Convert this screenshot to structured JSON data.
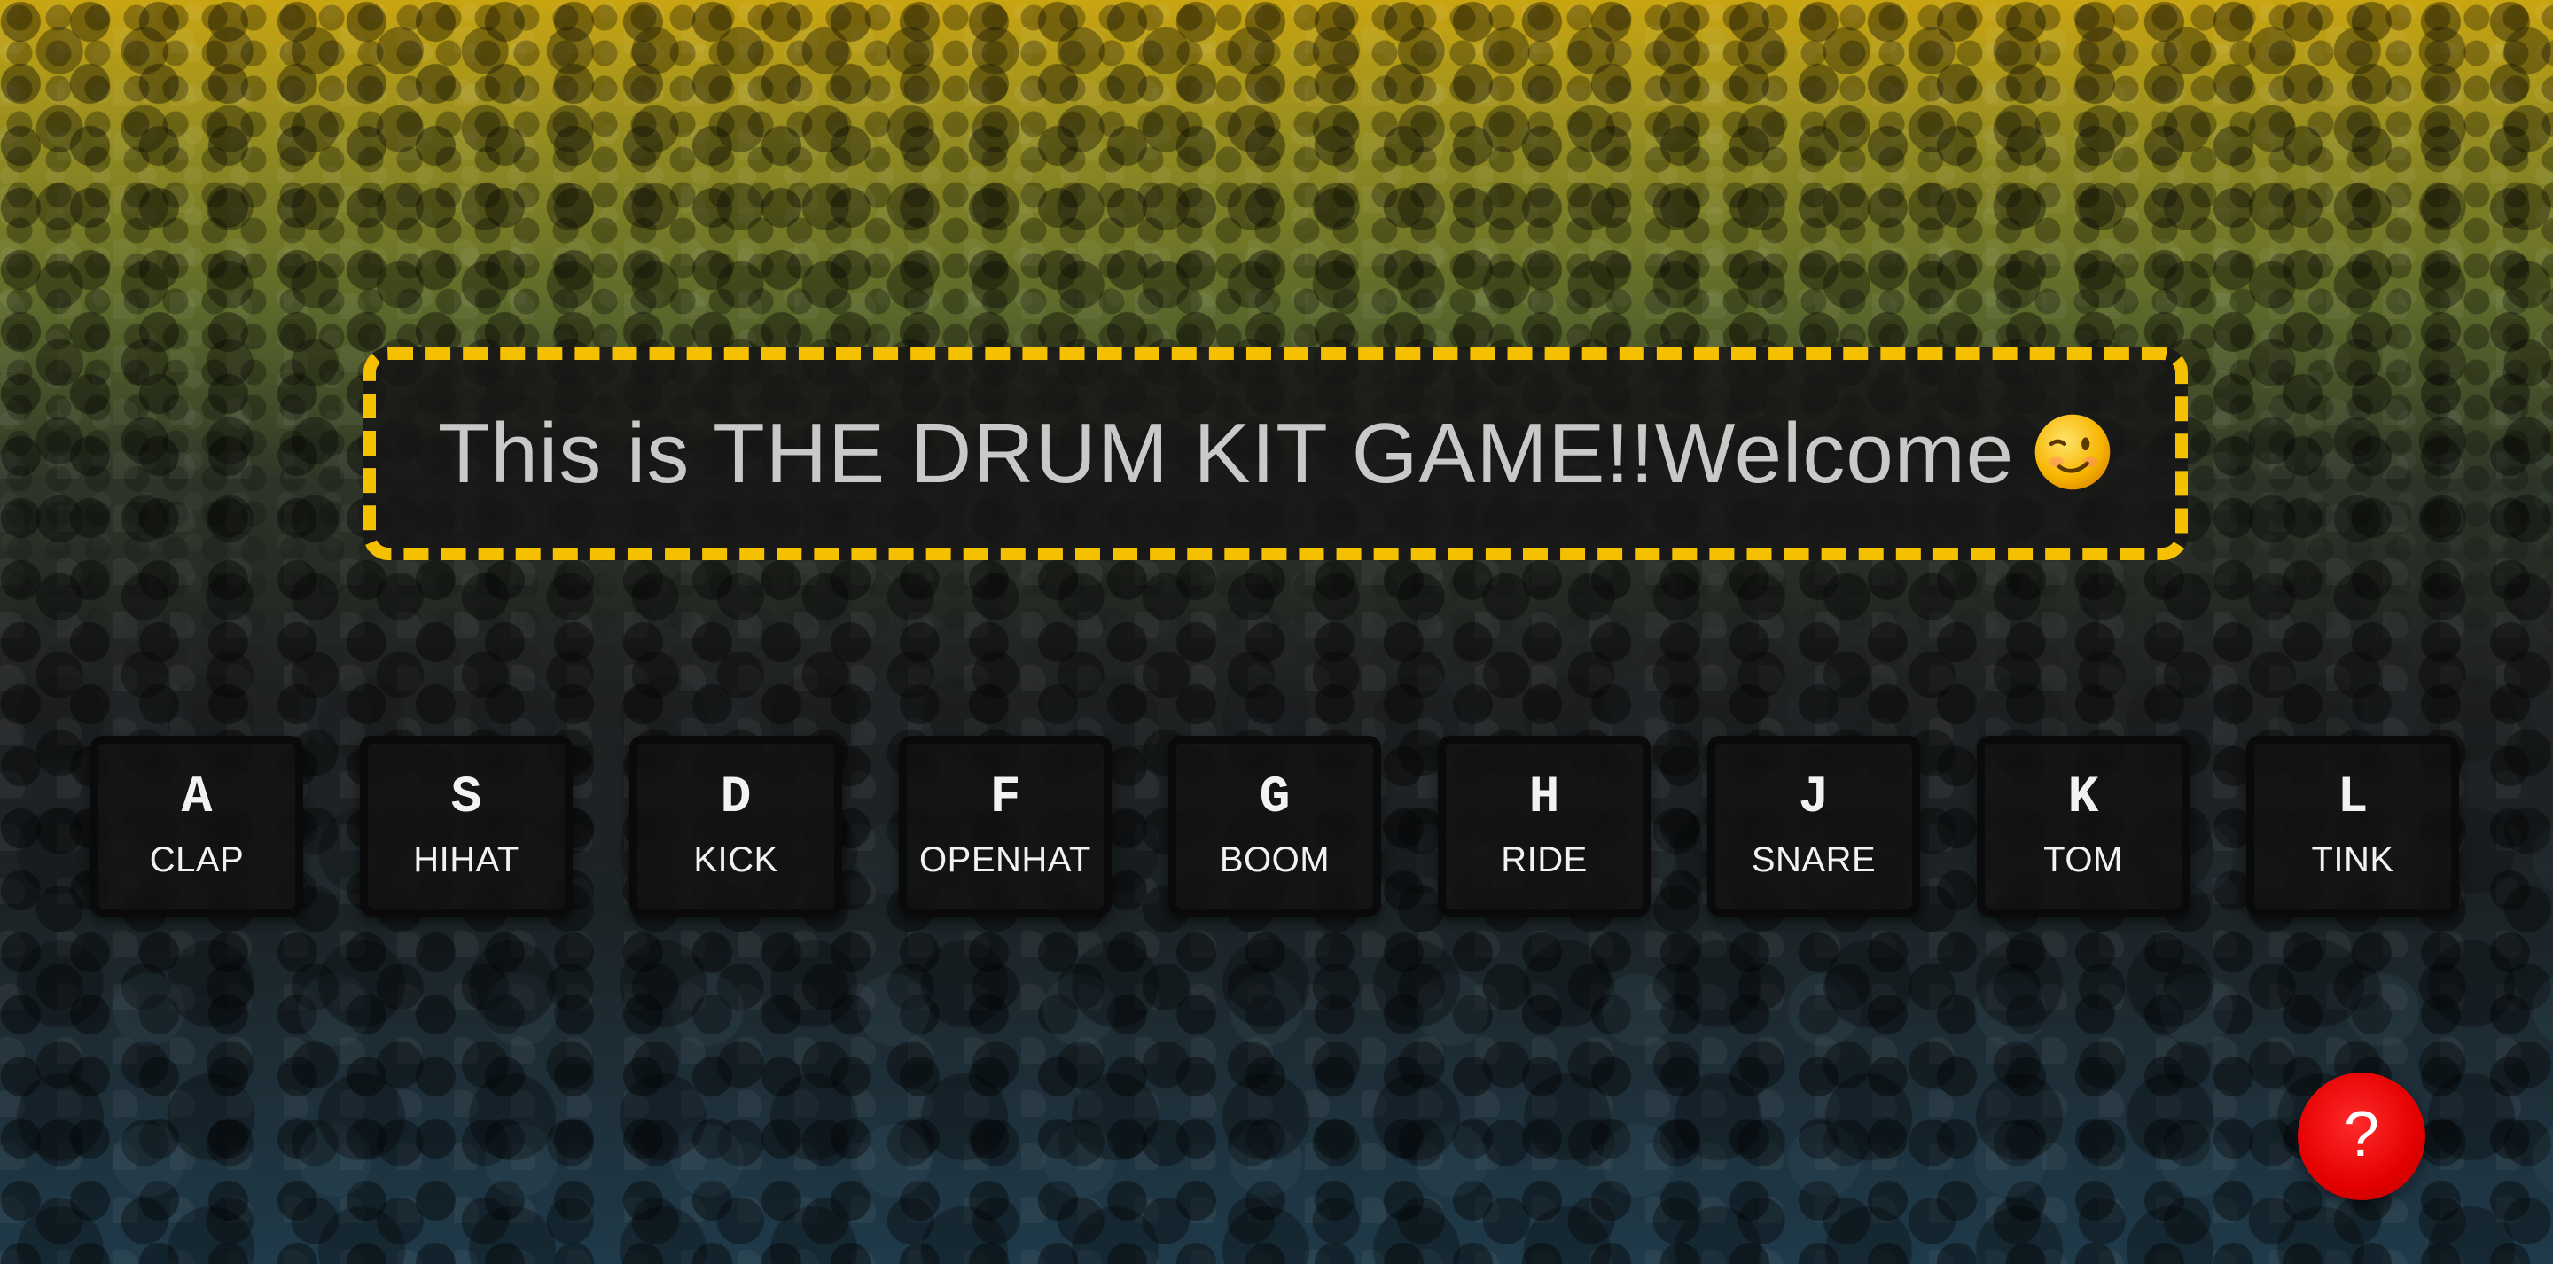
{
  "title": {
    "text": "This is THE DRUM KIT GAME!!Welcome",
    "emoji_icon": "winking-face-icon",
    "border_color": "#f5c000"
  },
  "keys": [
    {
      "key": "A",
      "sound": "CLAP"
    },
    {
      "key": "S",
      "sound": "HIHAT"
    },
    {
      "key": "D",
      "sound": "KICK"
    },
    {
      "key": "F",
      "sound": "OPENHAT"
    },
    {
      "key": "G",
      "sound": "BOOM"
    },
    {
      "key": "H",
      "sound": "RIDE"
    },
    {
      "key": "J",
      "sound": "SNARE"
    },
    {
      "key": "K",
      "sound": "TOM"
    },
    {
      "key": "L",
      "sound": "TINK"
    }
  ],
  "help": {
    "label": "?",
    "color": "#e40000"
  },
  "background": {
    "description_icon": "crowd-background-image",
    "accent_top": "#c9a512",
    "accent_bottom": "#1f3a4a"
  }
}
